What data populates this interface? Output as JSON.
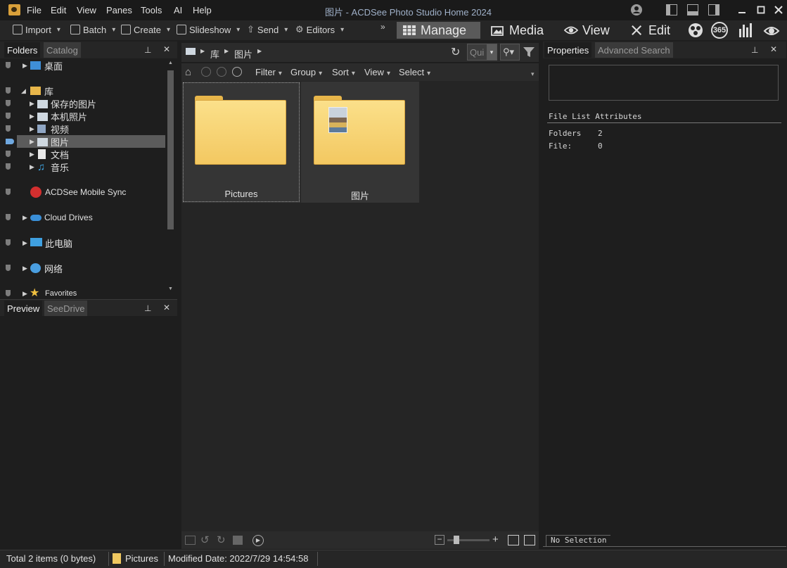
{
  "window": {
    "title": "图片 - ACDSee Photo Studio Home 2024",
    "menu": [
      "File",
      "Edit",
      "View",
      "Panes",
      "Tools",
      "AI",
      "Help"
    ]
  },
  "toolbar": {
    "items": [
      "Import",
      "Batch",
      "Create",
      "Slideshow",
      "Send",
      "Editors"
    ],
    "modes": [
      "Manage",
      "Media",
      "View",
      "Edit"
    ],
    "badge_365": "365"
  },
  "left_panel": {
    "tabs": [
      "Folders",
      "Catalog"
    ],
    "tree": [
      {
        "label": "桌面"
      },
      {
        "label": "库"
      },
      {
        "label": "保存的图片"
      },
      {
        "label": "本机照片"
      },
      {
        "label": "视频"
      },
      {
        "label": "图片"
      },
      {
        "label": "文档"
      },
      {
        "label": "音乐"
      },
      {
        "label": "ACDSee Mobile Sync"
      },
      {
        "label": "Cloud Drives"
      },
      {
        "label": "此电脑"
      },
      {
        "label": "网络"
      },
      {
        "label": "Favorites"
      }
    ],
    "preview_tabs": [
      "Preview",
      "SeeDrive"
    ]
  },
  "center": {
    "breadcrumb": [
      "库",
      "图片"
    ],
    "quick_search_placeholder": "Qui",
    "filter_menu": [
      "Filter",
      "Group",
      "Sort",
      "View",
      "Select"
    ],
    "thumbnails": [
      {
        "label": "Pictures"
      },
      {
        "label": "图片"
      }
    ]
  },
  "right_panel": {
    "tabs": [
      "Properties",
      "Advanced Search"
    ],
    "section_title": "File List Attributes",
    "attributes": [
      {
        "key": "Folders",
        "value": "2"
      },
      {
        "key": "File:",
        "value": "0"
      }
    ],
    "no_selection": "No Selection"
  },
  "status": {
    "total": "Total 2 items  (0 bytes)",
    "folder": "Pictures",
    "modified": "Modified Date: 2022/7/29 14:54:58"
  }
}
